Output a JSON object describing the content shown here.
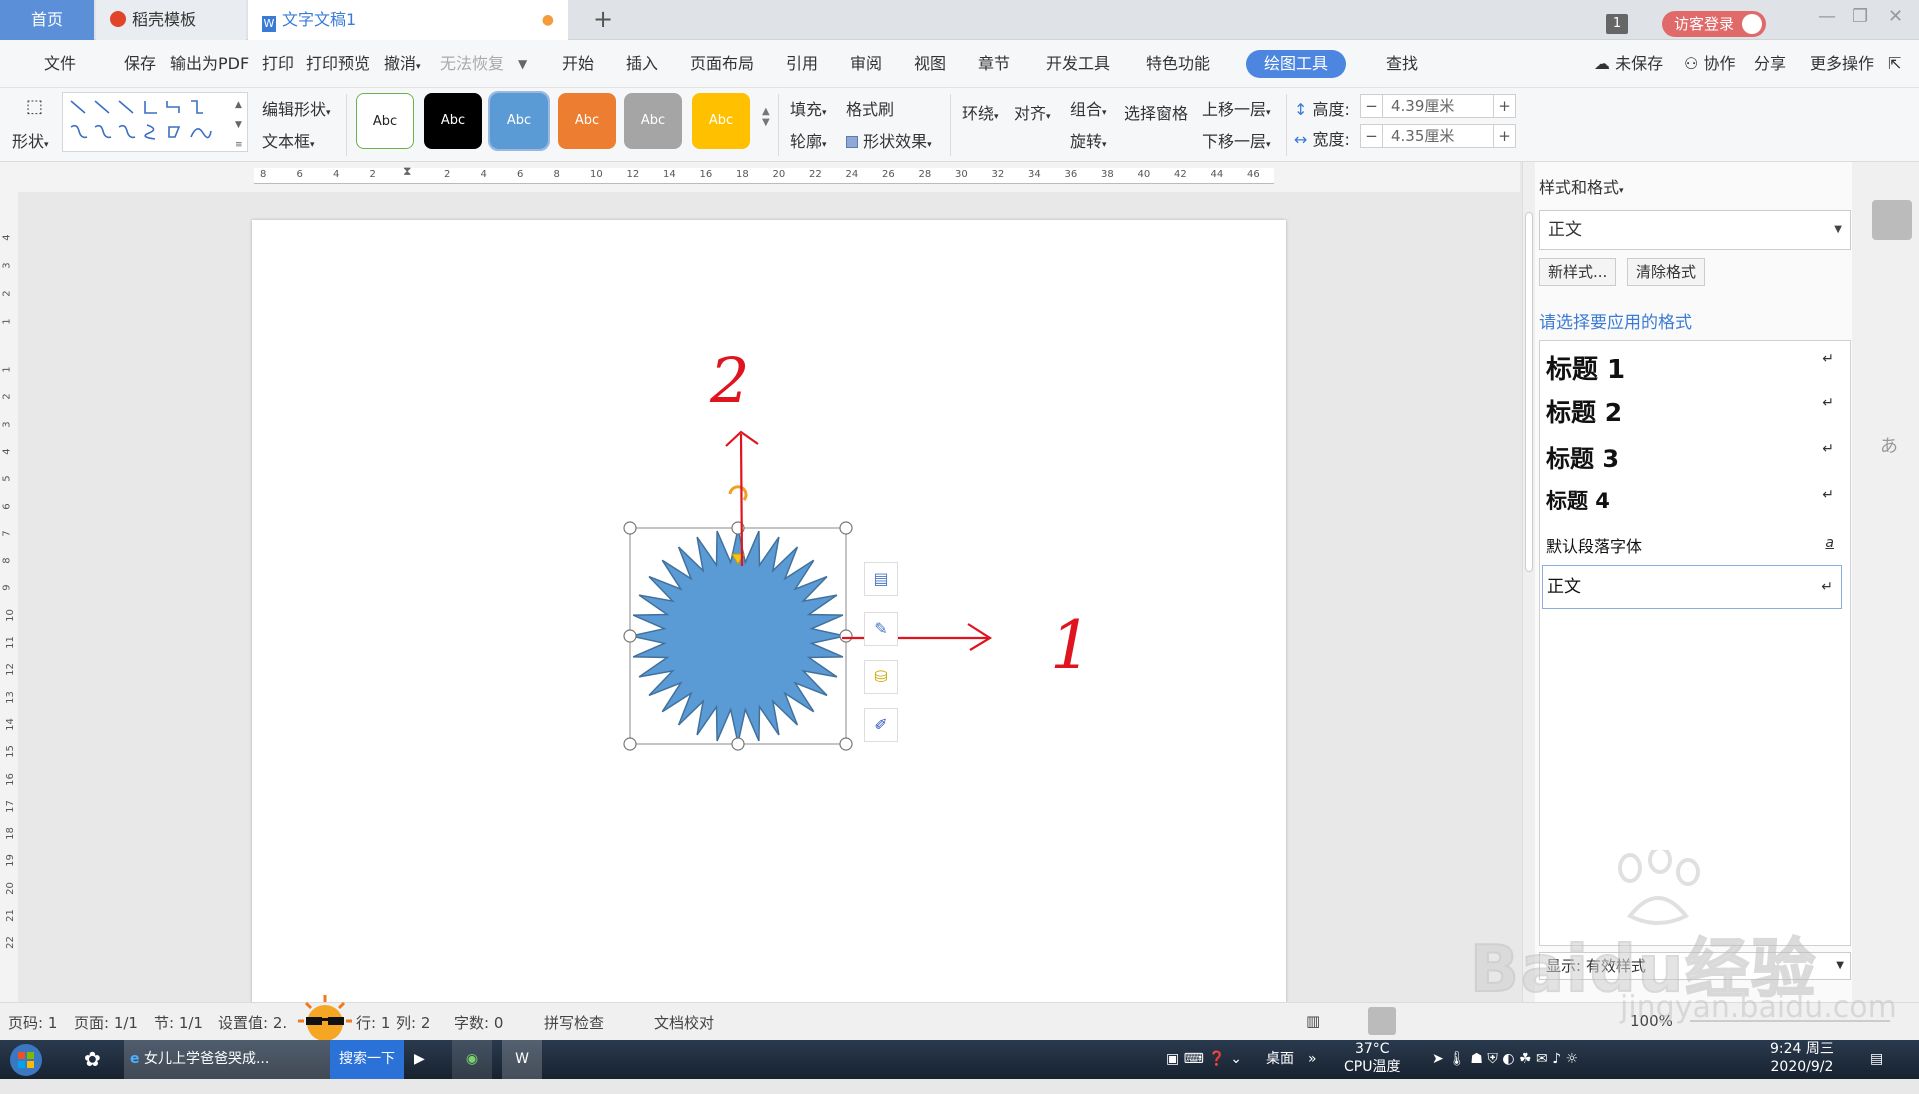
{
  "tabs": {
    "home": "首页",
    "docer": "稻壳模板",
    "doc": "文字文稿1",
    "window_count": "1",
    "guest_login": "访客登录"
  },
  "menubar": {
    "file": "文件",
    "save": "保存",
    "export_pdf": "输出为PDF",
    "print": "打印",
    "print_preview": "打印预览",
    "undo": "撤消",
    "redo": "无法恢复",
    "start": "开始",
    "insert": "插入",
    "page_layout": "页面布局",
    "references": "引用",
    "review": "审阅",
    "view": "视图",
    "chapter": "章节",
    "dev_tools": "开发工具",
    "special": "特色功能",
    "drawing_tools": "绘图工具",
    "find": "查找",
    "unsaved": "未保存",
    "collaborate": "协作",
    "share": "分享",
    "more": "更多操作"
  },
  "toolbar": {
    "shape": "形状",
    "edit_shape": "编辑形状",
    "text_box": "文本框",
    "swatch_label": "Abc",
    "fill": "填充",
    "format_painter": "格式刷",
    "outline": "轮廓",
    "shape_effect": "形状效果",
    "wrap": "环绕",
    "align": "对齐",
    "group": "组合",
    "select_pane": "选择窗格",
    "bring_forward": "上移一层",
    "rotate": "旋转",
    "send_backward": "下移一层",
    "height_label": "高度:",
    "height_value": "4.39厘米",
    "width_label": "宽度:",
    "width_value": "4.35厘米"
  },
  "ruler": {
    "h_left": [
      "8",
      "6",
      "4",
      "2"
    ],
    "h_right": [
      "2",
      "4",
      "6",
      "8",
      "10",
      "12",
      "14",
      "16",
      "18",
      "20",
      "22",
      "24",
      "26",
      "28",
      "30",
      "32",
      "34",
      "36",
      "38",
      "40",
      "42",
      "44",
      "46"
    ],
    "v_top": [
      "4",
      "3",
      "2",
      "1"
    ],
    "v_main": [
      "1",
      "2",
      "3",
      "4",
      "5",
      "6",
      "7",
      "8",
      "9",
      "10",
      "11",
      "12",
      "13",
      "14",
      "15",
      "16",
      "17",
      "18",
      "19",
      "20",
      "21",
      "22"
    ]
  },
  "annotations": {
    "label_up": "2",
    "label_right": "1"
  },
  "sidepanel": {
    "title": "样式和格式",
    "current_style": "正文",
    "new_style": "新样式...",
    "clear_format": "清除格式",
    "apply_prompt": "请选择要应用的格式",
    "styles": [
      {
        "name": "标题  1"
      },
      {
        "name": "标题  2"
      },
      {
        "name": "标题  3"
      },
      {
        "name": "标题  4"
      },
      {
        "name": "默认段落字体"
      },
      {
        "name": "正文"
      }
    ],
    "show_label": "显示:",
    "show_value": "有效样式"
  },
  "statusbar": {
    "page_num": "页码: 1",
    "pages": "页面: 1/1",
    "section": "节: 1/1",
    "setting": "设置值: 2.",
    "row": "行: 1",
    "col": "列: 2",
    "words": "字数: 0",
    "spell_check": "拼写检查",
    "doc_proof": "文档校对",
    "zoom": "100%"
  },
  "taskbar": {
    "ie_task": "女儿上学爸爸哭成...",
    "search_btn": "搜索一下",
    "desktop": "桌面",
    "temperature": "37°C",
    "cpu_temp": "CPU温度",
    "time": "9:24 周三",
    "date": "2020/9/2"
  },
  "watermark": {
    "brand": "Baidu经验",
    "url": "jingyan.baidu.com"
  },
  "colors": {
    "accent": "#4c86e0",
    "shape_fill": "#5b9bd5",
    "shape_stroke": "#41719c",
    "annotation": "#e0141e"
  }
}
